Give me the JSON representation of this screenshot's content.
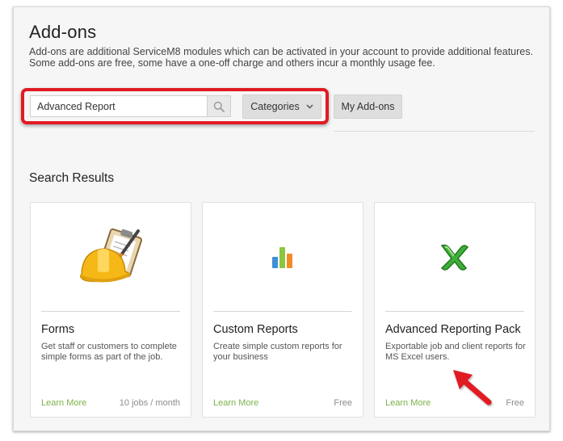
{
  "header": {
    "title": "Add-ons",
    "description": "Add-ons are additional ServiceM8 modules which can be activated in your account to provide additional features. Some add-ons are free, some have a one-off charge and others incur a monthly usage fee."
  },
  "search": {
    "value": "Advanced Report",
    "button_icon": "search-icon"
  },
  "toolbar": {
    "categories_label": "Categories",
    "categories_icon": "chevron-down-icon",
    "my_addons_label": "My Add-ons"
  },
  "results": {
    "title": "Search Results",
    "cards": [
      {
        "icon": "forms-hardhat-clipboard-icon",
        "title": "Forms",
        "description": "Get staff or customers to complete simple forms as part of the job.",
        "link_label": "Learn More",
        "price": "10 jobs / month"
      },
      {
        "icon": "bar-chart-icon",
        "title": "Custom Reports",
        "description": "Create simple custom reports for your business",
        "link_label": "Learn More",
        "price": "Free"
      },
      {
        "icon": "excel-icon",
        "title": "Advanced Reporting Pack",
        "description": "Exportable job and client reports for MS Excel users.",
        "link_label": "Learn More",
        "price": "Free"
      }
    ]
  },
  "annotations": {
    "highlight_color": "#e01a22",
    "arrow_color": "#e01a22"
  },
  "colors": {
    "link": "#7cb24a",
    "panel_background": "#f6f6f6"
  }
}
